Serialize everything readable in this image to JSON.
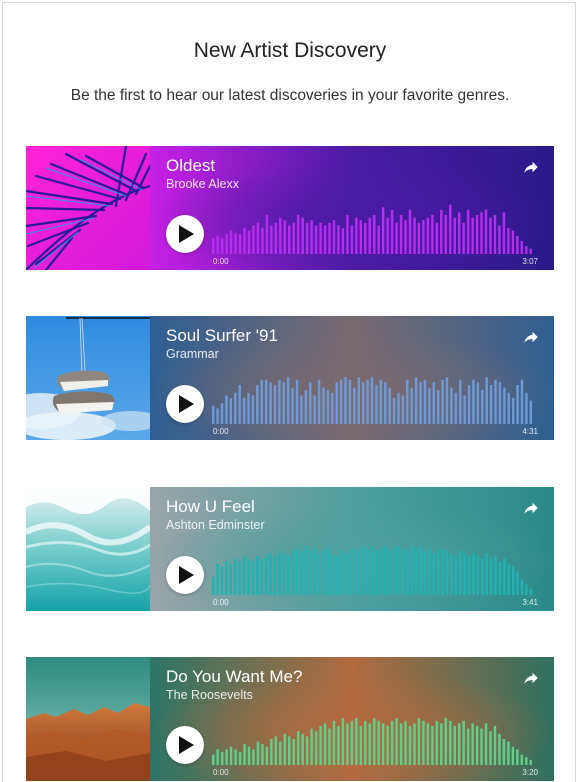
{
  "header": {
    "title": "New Artist Discovery",
    "subtitle": "Be the first to hear our latest discoveries in your favorite genres."
  },
  "tracks": [
    {
      "title": "Oldest",
      "artist": "Brooke Alexx",
      "start_time": "0:00",
      "duration": "3:07",
      "progress": 0,
      "cover_icon": "palm-leaf-icon",
      "wave_color": "#b62cf0",
      "bg_colors": [
        "#c81fe6",
        "#4a1ba3",
        "#2a1a8a"
      ],
      "waveform": [
        0.3,
        0.35,
        0.3,
        0.4,
        0.45,
        0.4,
        0.38,
        0.5,
        0.45,
        0.55,
        0.6,
        0.5,
        0.75,
        0.55,
        0.6,
        0.7,
        0.65,
        0.55,
        0.6,
        0.75,
        0.7,
        0.6,
        0.65,
        0.55,
        0.6,
        0.55,
        0.6,
        0.65,
        0.55,
        0.5,
        0.75,
        0.55,
        0.7,
        0.65,
        0.6,
        0.7,
        0.75,
        0.55,
        0.9,
        0.7,
        0.85,
        0.6,
        0.75,
        0.65,
        0.85,
        0.7,
        0.6,
        0.65,
        0.7,
        0.75,
        0.6,
        0.85,
        0.75,
        0.95,
        0.7,
        0.8,
        0.6,
        0.85,
        0.7,
        0.75,
        0.8,
        0.85,
        0.7,
        0.75,
        0.55,
        0.8,
        0.5,
        0.45,
        0.35,
        0.25,
        0.15,
        0.1
      ]
    },
    {
      "title": "Soul Surfer '91",
      "artist": "Grammar",
      "start_time": "0:00",
      "duration": "4:31",
      "progress": 0,
      "cover_icon": "hanging-sneakers-icon",
      "wave_color": "#6f9ad8",
      "bg_colors": [
        "#2e5e93",
        "#7a6a70",
        "#2f5f92"
      ],
      "waveform": [
        0.35,
        0.3,
        0.4,
        0.55,
        0.5,
        0.6,
        0.75,
        0.5,
        0.6,
        0.55,
        0.75,
        0.85,
        0.85,
        0.8,
        0.75,
        0.85,
        0.8,
        0.9,
        0.7,
        0.85,
        0.55,
        0.65,
        0.8,
        0.55,
        0.85,
        0.7,
        0.65,
        0.6,
        0.8,
        0.85,
        0.9,
        0.85,
        0.7,
        0.9,
        0.8,
        0.85,
        0.9,
        0.75,
        0.85,
        0.8,
        0.7,
        0.5,
        0.6,
        0.55,
        0.85,
        0.7,
        0.9,
        0.8,
        0.85,
        0.7,
        0.8,
        0.65,
        0.85,
        0.9,
        0.7,
        0.6,
        0.85,
        0.55,
        0.75,
        0.85,
        0.8,
        0.65,
        0.9,
        0.75,
        0.85,
        0.8,
        0.7,
        0.6,
        0.5,
        0.75,
        0.85,
        0.6,
        0.45
      ]
    },
    {
      "title": "How U Feel",
      "artist": "Ashton Edminster",
      "start_time": "0:00",
      "duration": "3:41",
      "progress": 0,
      "cover_icon": "ocean-waves-icon",
      "wave_color": "#1fb3b3",
      "bg_colors": [
        "#9aa4a8",
        "#4f9f9f",
        "#2a8a89"
      ],
      "waveform": [
        0.35,
        0.6,
        0.55,
        0.65,
        0.6,
        0.7,
        0.65,
        0.75,
        0.7,
        0.65,
        0.75,
        0.7,
        0.75,
        0.8,
        0.75,
        0.85,
        0.8,
        0.75,
        0.85,
        0.9,
        0.85,
        0.95,
        0.85,
        0.9,
        0.8,
        0.85,
        0.9,
        0.8,
        0.75,
        0.85,
        0.8,
        0.85,
        0.9,
        0.85,
        0.95,
        0.9,
        0.95,
        0.85,
        0.9,
        0.95,
        0.85,
        0.9,
        0.95,
        0.9,
        0.85,
        0.95,
        0.9,
        0.95,
        0.85,
        0.9,
        0.8,
        0.85,
        0.9,
        0.85,
        0.8,
        0.75,
        0.85,
        0.8,
        0.75,
        0.8,
        0.75,
        0.7,
        0.8,
        0.7,
        0.75,
        0.65,
        0.7,
        0.6,
        0.55,
        0.45,
        0.3,
        0.2,
        0.12
      ]
    },
    {
      "title": "Do You Want Me?",
      "artist": "The Roosevelts",
      "start_time": "0:00",
      "duration": "3:20",
      "progress": 0,
      "cover_icon": "desert-landscape-icon",
      "wave_color": "#5fd08c",
      "bg_colors": [
        "#2c7566",
        "#b36a3e",
        "#2f7060"
      ],
      "waveform": [
        0.2,
        0.3,
        0.25,
        0.3,
        0.35,
        0.3,
        0.25,
        0.4,
        0.35,
        0.3,
        0.45,
        0.4,
        0.35,
        0.5,
        0.55,
        0.45,
        0.6,
        0.55,
        0.5,
        0.65,
        0.6,
        0.55,
        0.7,
        0.65,
        0.75,
        0.8,
        0.7,
        0.85,
        0.75,
        0.9,
        0.8,
        0.85,
        0.9,
        0.75,
        0.85,
        0.8,
        0.9,
        0.85,
        0.8,
        0.75,
        0.85,
        0.9,
        0.8,
        0.85,
        0.75,
        0.8,
        0.9,
        0.85,
        0.8,
        0.75,
        0.85,
        0.8,
        0.9,
        0.85,
        0.75,
        0.8,
        0.85,
        0.7,
        0.8,
        0.75,
        0.7,
        0.8,
        0.65,
        0.75,
        0.6,
        0.5,
        0.45,
        0.35,
        0.3,
        0.2,
        0.15,
        0.1
      ]
    }
  ]
}
